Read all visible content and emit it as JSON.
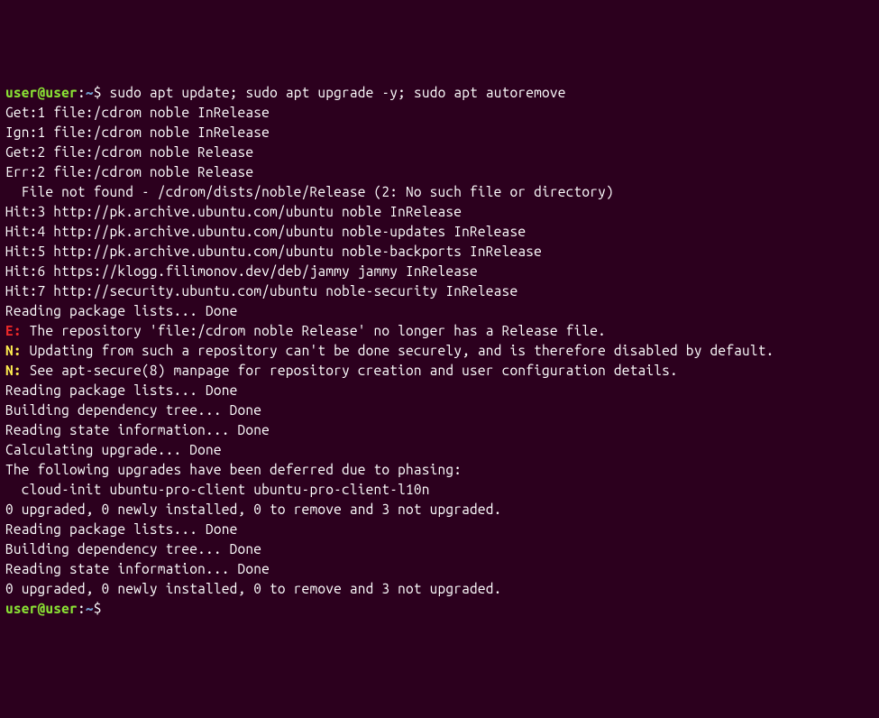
{
  "prompt1": {
    "user": "user",
    "at": "@",
    "host": "user",
    "path": "~",
    "command": "sudo apt update; sudo apt upgrade -y; sudo apt autoremove"
  },
  "lines": [
    {
      "kind": "plain",
      "text": "Get:1 file:/cdrom noble InRelease"
    },
    {
      "kind": "plain",
      "text": "Ign:1 file:/cdrom noble InRelease"
    },
    {
      "kind": "plain",
      "text": "Get:2 file:/cdrom noble Release"
    },
    {
      "kind": "plain",
      "text": "Err:2 file:/cdrom noble Release"
    },
    {
      "kind": "plain",
      "text": "  File not found - /cdrom/dists/noble/Release (2: No such file or directory)"
    },
    {
      "kind": "plain",
      "text": "Hit:3 http://pk.archive.ubuntu.com/ubuntu noble InRelease"
    },
    {
      "kind": "plain",
      "text": "Hit:4 http://pk.archive.ubuntu.com/ubuntu noble-updates InRelease"
    },
    {
      "kind": "plain",
      "text": "Hit:5 http://pk.archive.ubuntu.com/ubuntu noble-backports InRelease"
    },
    {
      "kind": "plain",
      "text": "Hit:6 https://klogg.filimonov.dev/deb/jammy jammy InRelease"
    },
    {
      "kind": "plain",
      "text": "Hit:7 http://security.ubuntu.com/ubuntu noble-security InRelease"
    },
    {
      "kind": "plain",
      "text": "Reading package lists... Done"
    },
    {
      "kind": "error",
      "prefix": "E:",
      "text": " The repository 'file:/cdrom noble Release' no longer has a Release file."
    },
    {
      "kind": "notice",
      "prefix": "N:",
      "text": " Updating from such a repository can't be done securely, and is therefore disabled by default."
    },
    {
      "kind": "notice",
      "prefix": "N:",
      "text": " See apt-secure(8) manpage for repository creation and user configuration details."
    },
    {
      "kind": "plain",
      "text": "Reading package lists... Done"
    },
    {
      "kind": "plain",
      "text": "Building dependency tree... Done"
    },
    {
      "kind": "plain",
      "text": "Reading state information... Done"
    },
    {
      "kind": "plain",
      "text": "Calculating upgrade... Done"
    },
    {
      "kind": "plain",
      "text": "The following upgrades have been deferred due to phasing:"
    },
    {
      "kind": "plain",
      "text": "  cloud-init ubuntu-pro-client ubuntu-pro-client-l10n"
    },
    {
      "kind": "plain",
      "text": "0 upgraded, 0 newly installed, 0 to remove and 3 not upgraded."
    },
    {
      "kind": "plain",
      "text": "Reading package lists... Done"
    },
    {
      "kind": "plain",
      "text": "Building dependency tree... Done"
    },
    {
      "kind": "plain",
      "text": "Reading state information... Done"
    },
    {
      "kind": "plain",
      "text": "0 upgraded, 0 newly installed, 0 to remove and 3 not upgraded."
    }
  ],
  "prompt2": {
    "user": "user",
    "at": "@",
    "host": "user",
    "path": "~",
    "command": ""
  }
}
